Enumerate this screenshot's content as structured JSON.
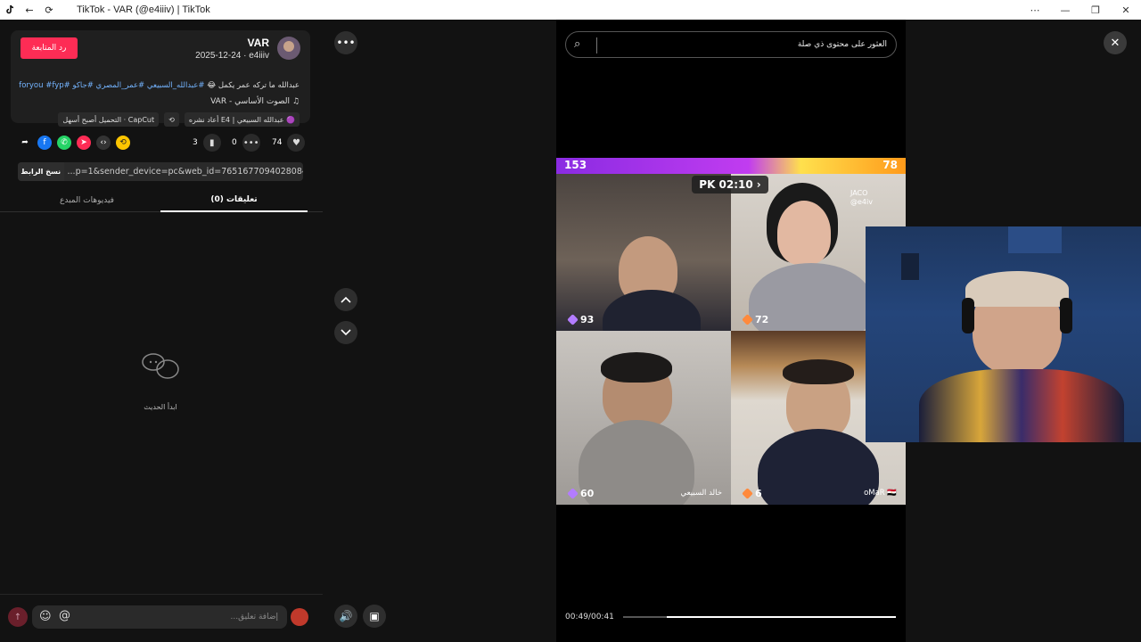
{
  "window": {
    "title": "TikTok - VAR (@e4iiiv) | TikTok",
    "controls": [
      "⋯",
      "—",
      "❐",
      "✕"
    ]
  },
  "post": {
    "username": "VAR",
    "handle_date": "2025-12-24 · e4iiiv",
    "follow_label": "رد المتابعة",
    "description_text": "عبدالله ما تركه عمر يكمل 😂",
    "description_tags": "#عبدالله_السبيعي #عمر_المصري #جاكو #foryou #fyp",
    "sound": "الصوت الأساسي - VAR",
    "chips": [
      "🟣 عبدالله السبيعي | E4 أعاد نشره",
      "⟲",
      "CapCut · التحميل أصبح أسهل"
    ]
  },
  "stats": {
    "likes": "74",
    "comments": "0",
    "saves": "3"
  },
  "share_link": {
    "copy_label": "نسخ الرابط",
    "url": "...p=1&sender_device=pc&web_id=7651677094028084743"
  },
  "tabs": {
    "comments": "تعليقات (0)",
    "creator_videos": "فيديوهات المبدع"
  },
  "empty_state": {
    "text": "ابدأ الحديث"
  },
  "comment_bar": {
    "placeholder": "إضافة تعليق..."
  },
  "search": {
    "placeholder": "العثور على محتوى ذي صلة"
  },
  "video": {
    "pk_left": "153",
    "pk_right": "78",
    "pk_timer": "PK 02:10",
    "pk_arrow": "›",
    "jaco_name": "JACO",
    "jaco_handle": "@e4iv",
    "scores": [
      "93",
      "72",
      "60",
      "6"
    ],
    "names": [
      "خالد السبيعي",
      "oMaR 🇪🇬"
    ],
    "time": "00:49/00:41",
    "progress_fraction": 0.84
  },
  "colors": {
    "accent": "#fe2c55",
    "link": "#74b4ff"
  }
}
